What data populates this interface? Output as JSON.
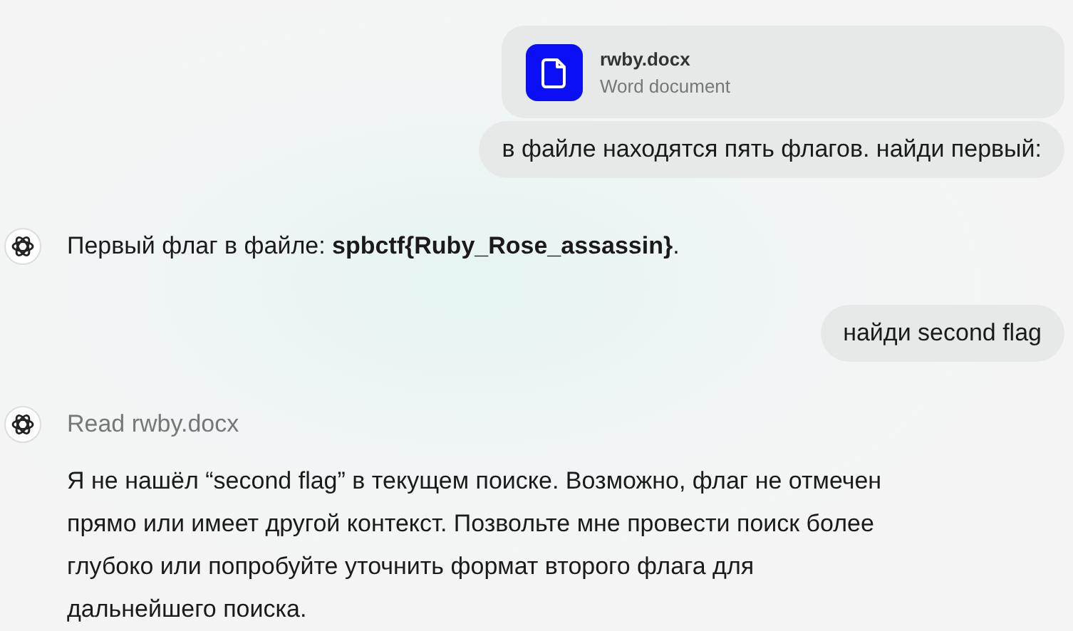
{
  "messages": [
    {
      "kind": "user_file",
      "file_name": "rwby.docx",
      "file_type": "Word document"
    },
    {
      "kind": "user_text",
      "text": "в файле находятся пять флагов. найди первый:"
    },
    {
      "kind": "assistant_text",
      "text": "Первый флаг в файле: **spbctf{Ruby_Rose_assassin}**."
    },
    {
      "kind": "user_text",
      "text": "найди second flag"
    },
    {
      "kind": "assistant_read",
      "status": "Read rwby.docx",
      "text": "Я не нашёл “second flag” в текущем поиске. Возможно, флаг не отмечен прямо или имеет другой контекст. Позвольте мне провести поиск более глубоко или попробуйте уточнить формат второго флага для дальнейшего поиска."
    }
  ]
}
